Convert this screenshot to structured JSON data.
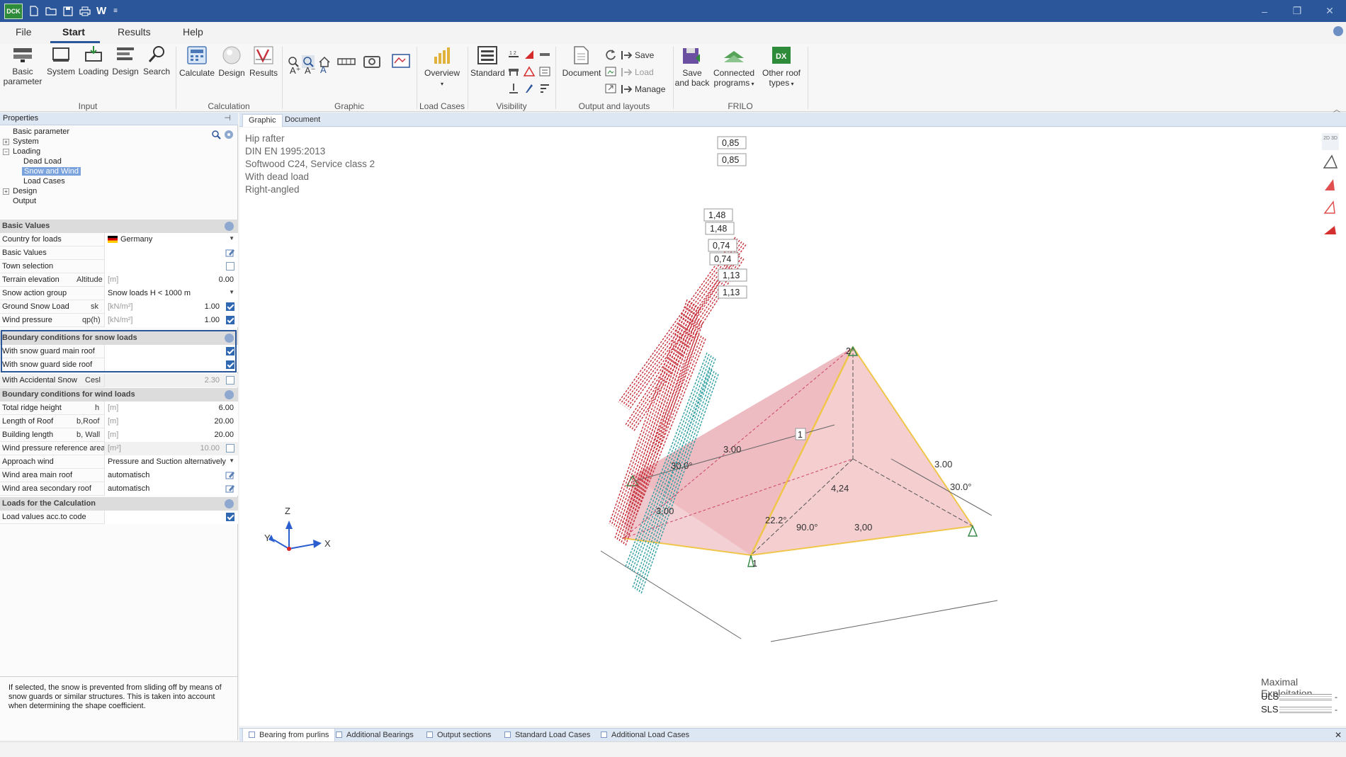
{
  "titlebar": {
    "logo": "DCK",
    "w_icon": "W",
    "more": "≡",
    "minimize": "–",
    "restore": "❐",
    "close": "✕"
  },
  "menu": {
    "file": "File",
    "start": "Start",
    "results": "Results",
    "help": "Help"
  },
  "ribbon": {
    "input": {
      "label": "Input",
      "basic_parameter": "Basic parameter",
      "system": "System",
      "loading": "Loading",
      "design": "Design",
      "search": "Search"
    },
    "calculation": {
      "label": "Calculation",
      "calculate": "Calculate",
      "design": "Design",
      "results": "Results"
    },
    "graphic": {
      "label": "Graphic"
    },
    "load_cases": {
      "label": "Load Cases",
      "overview": "Overview"
    },
    "visibility": {
      "label": "Visibility",
      "standard": "Standard"
    },
    "output": {
      "label": "Output and layouts",
      "document": "Document",
      "save": "Save",
      "load": "Load",
      "manage": "Manage"
    },
    "frilo": {
      "label": "FRILO",
      "save_and_back": "Save and back",
      "connected_programs": "Connected programs",
      "other_roof_types": "Other roof types"
    }
  },
  "properties": {
    "header": "Properties",
    "tree": {
      "basic_parameter": "Basic parameter",
      "system": "System",
      "loading": "Loading",
      "dead_load": "Dead Load",
      "snow_and_wind": "Snow and Wind",
      "load_cases": "Load Cases",
      "design": "Design",
      "output": "Output"
    },
    "sections": {
      "basic_values": "Basic Values",
      "snow_boundary": "Boundary conditions for snow loads",
      "wind_boundary": "Boundary conditions for wind loads",
      "calc_loads": "Loads for the Calculation"
    },
    "rows": {
      "country": {
        "name": "Country for loads",
        "value": "Germany"
      },
      "basic_values": {
        "name": "Basic Values"
      },
      "town_selection": {
        "name": "Town selection"
      },
      "terrain": {
        "name": "Terrain elevation",
        "symbol": "Altitude",
        "unit": "[m]",
        "value": "0.00"
      },
      "snow_group": {
        "name": "Snow action group",
        "value": "Snow loads H < 1000 m"
      },
      "ground_snow": {
        "name": "Ground Snow Load",
        "symbol": "sk",
        "unit": "[kN/m²]",
        "value": "1.00"
      },
      "wind_pressure": {
        "name": "Wind pressure",
        "symbol": "qp(h)",
        "unit": "[kN/m²]",
        "value": "1.00"
      },
      "snow_guard_main": {
        "name": "With snow guard main roof"
      },
      "snow_guard_side": {
        "name": "With snow guard side roof"
      },
      "accidental_snow": {
        "name": "With Accidental Snow",
        "symbol": "Cesl",
        "value": "2.30"
      },
      "ridge_height": {
        "name": "Total ridge height",
        "symbol": "h",
        "unit": "[m]",
        "value": "6.00"
      },
      "roof_length": {
        "name": "Length of Roof",
        "symbol": "b,Roof",
        "unit": "[m]",
        "value": "20.00"
      },
      "building_length": {
        "name": "Building length",
        "symbol": "b, Wall",
        "unit": "[m]",
        "value": "20.00"
      },
      "wind_ref_area": {
        "name": "Wind pressure reference area",
        "unit": "[m²]",
        "value": "10.00"
      },
      "approach_wind": {
        "name": "Approach wind",
        "value": "Pressure and Suction alternatively"
      },
      "wind_area_main": {
        "name": "Wind area main roof",
        "value": "automatisch"
      },
      "wind_area_secondary": {
        "name": "Wind area secondary roof",
        "value": "automatisch"
      },
      "load_values_code": {
        "name": "Load values acc.to code"
      }
    },
    "help_text": "If selected, the snow is prevented from sliding off by means of snow guards or similar structures. This is taken into account when determining the shape coefficient."
  },
  "view_tabs": {
    "graphic": "Graphic",
    "document": "Document"
  },
  "graphic_info": [
    "Hip rafter",
    "DIN EN 1995:2013",
    "Softwood C24, Service class 2",
    "With dead load",
    "Right-angled"
  ],
  "load_labels": [
    "0,85",
    "0,85",
    "1,48",
    "1,48",
    "0,74",
    "0,74",
    "1,13",
    "1,13"
  ],
  "dimensions": {
    "d_left_top": "3.00",
    "d_right_top": "3.00",
    "d_left_front": "3,00",
    "d_front": "3,00",
    "d_hip": "4,24",
    "a_left": "30.0°",
    "a_right": "30.0°",
    "a_hip": "22.2°",
    "a_corner": "90.0°",
    "node1": "1",
    "node2": "2",
    "node1b": "1"
  },
  "axes": {
    "z": "Z",
    "y": "Y",
    "x": "X"
  },
  "side_tools": {
    "view_2d3d": "2D 3D"
  },
  "exploitation": {
    "title": "Maximal Exploitation",
    "uls": "ULS",
    "sls": "SLS",
    "uls_value": "-",
    "sls_value": "-"
  },
  "bottom_tabs": [
    "Bearing from purlins",
    "Additional Bearings",
    "Output sections",
    "Standard Load Cases",
    "Additional Load Cases"
  ],
  "bottom_close": "✕",
  "colors": {
    "accent": "#2b579a",
    "roof_fill": "#f1c3c6",
    "snow_load": "#c8323c",
    "wind_load": "#2f9ea0",
    "edge": "#f0c64a"
  }
}
